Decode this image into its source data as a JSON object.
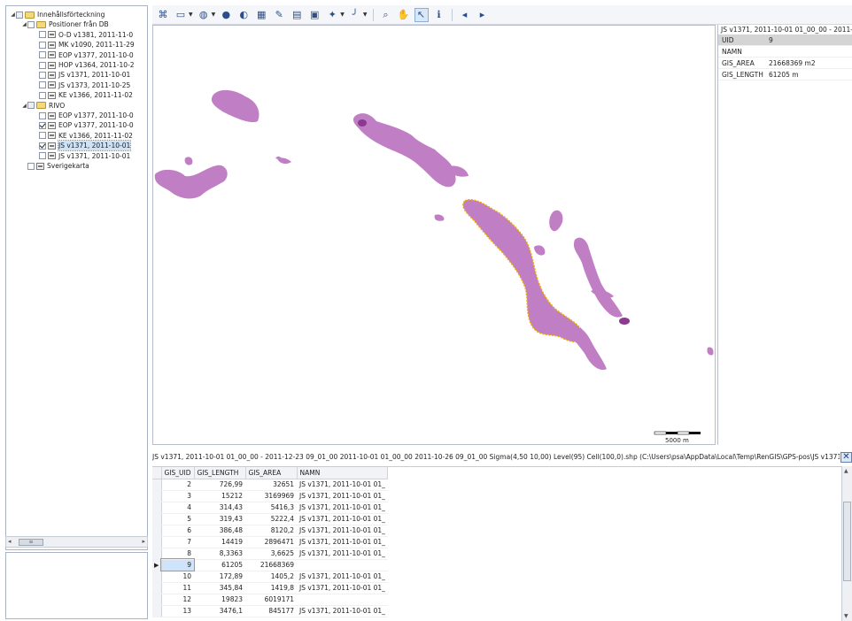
{
  "tree": {
    "items": [
      {
        "label": "Innehållsförteckning",
        "indent": 0,
        "icon": "folder-icon",
        "check": "partial",
        "expander": "▲"
      },
      {
        "label": "Positioner från DB",
        "indent": 1,
        "icon": "folder-icon",
        "check": "none",
        "expander": "▲"
      },
      {
        "label": "O-D v1381, 2011-11-0",
        "indent": 2,
        "icon": "layer-icon",
        "check": "none"
      },
      {
        "label": "MK v1090, 2011-11-29",
        "indent": 2,
        "icon": "layer-icon",
        "check": "none"
      },
      {
        "label": "EOP v1377, 2011-10-0",
        "indent": 2,
        "icon": "layer-icon",
        "check": "none"
      },
      {
        "label": "HOP v1364, 2011-10-2",
        "indent": 2,
        "icon": "layer-icon",
        "check": "none"
      },
      {
        "label": "JS v1371, 2011-10-01",
        "indent": 2,
        "icon": "layer-icon",
        "check": "none"
      },
      {
        "label": "JS v1373, 2011-10-25",
        "indent": 2,
        "icon": "layer-icon",
        "check": "none"
      },
      {
        "label": "KE v1366, 2011-11-02",
        "indent": 2,
        "icon": "layer-icon",
        "check": "none"
      },
      {
        "label": "RIVO",
        "indent": 1,
        "icon": "folder-icon",
        "check": "partial",
        "expander": "▲"
      },
      {
        "label": "EOP v1377, 2011-10-0",
        "indent": 2,
        "icon": "layer-icon",
        "check": "none"
      },
      {
        "label": "EOP v1377, 2011-10-0",
        "indent": 2,
        "icon": "layer-icon",
        "check": "checked"
      },
      {
        "label": "KE v1366, 2011-11-02",
        "indent": 2,
        "icon": "layer-icon",
        "check": "none"
      },
      {
        "label": "JS v1371, 2011-10-01",
        "indent": 2,
        "icon": "layer-icon",
        "check": "checked",
        "selected": true
      },
      {
        "label": "JS v1371, 2011-10-01",
        "indent": 2,
        "icon": "layer-icon",
        "check": "none"
      },
      {
        "label": "Sverigekarta",
        "indent": 1,
        "icon": "layer-icon",
        "check": "none"
      }
    ]
  },
  "toolbar": {
    "buttons": [
      {
        "name": "layers-icon",
        "glyph": "⌘"
      },
      {
        "name": "open-folder-icon",
        "glyph": "▭",
        "dropdown": true
      },
      {
        "name": "globe-icon",
        "glyph": "◍",
        "dropdown": true
      },
      {
        "name": "sphere-icon",
        "glyph": "●"
      },
      {
        "name": "half-sphere-icon",
        "glyph": "◐"
      },
      {
        "name": "grid-icon",
        "glyph": "▦"
      },
      {
        "name": "magic-wand-icon",
        "glyph": "✎"
      },
      {
        "name": "table-icon",
        "glyph": "▤"
      },
      {
        "name": "chart-icon",
        "glyph": "▣"
      },
      {
        "name": "paint-icon",
        "glyph": "✦",
        "dropdown": true
      },
      {
        "name": "line-tool-icon",
        "glyph": "╯",
        "dropdown": true
      },
      {
        "name": "zoom-icon",
        "glyph": "⌕"
      },
      {
        "name": "pan-icon",
        "glyph": "✋"
      },
      {
        "name": "select-arrow-icon",
        "glyph": "↖",
        "active": true
      },
      {
        "name": "identify-icon",
        "glyph": "ℹ"
      },
      {
        "name": "back-icon",
        "glyph": "◂"
      },
      {
        "name": "forward-icon",
        "glyph": "▸"
      }
    ]
  },
  "map": {
    "fill_color": "#c07ec4",
    "highlight_color": "#f0a500",
    "dark_spot_color": "#8a3a8f",
    "scale_label": "5000 m"
  },
  "properties": {
    "title": "JS v1371, 2011-10-01 01_00_00 - 2011-",
    "rows": [
      {
        "key": "UID",
        "value": "9",
        "header": true
      },
      {
        "key": "NAMN",
        "value": ""
      },
      {
        "key": "GIS_AREA",
        "value": "21668369 m2"
      },
      {
        "key": "GIS_LENGTH",
        "value": "61205 m"
      }
    ]
  },
  "table": {
    "path": "JS v1371, 2011-10-01 01_00_00 - 2011-12-23 09_01_00 2011-10-01 01_00_00 2011-10-26 09_01_00 Sigma(4,50 10,00) Level(95) Cell(100,0).shp (C:\\Users\\psa\\AppData\\Local\\Temp\\RenGIS\\GPS-pos\\JS v1371, 2",
    "columns": [
      "GIS_UID",
      "GIS_LENGTH",
      "GIS_AREA",
      "NAMN"
    ],
    "rows": [
      {
        "uid": "2",
        "length": "726,99",
        "area": "32651",
        "namn": "JS v1371, 2011-10-01 01_"
      },
      {
        "uid": "3",
        "length": "15212",
        "area": "3169969",
        "namn": "JS v1371, 2011-10-01 01_"
      },
      {
        "uid": "4",
        "length": "314,43",
        "area": "5416,3",
        "namn": "JS v1371, 2011-10-01 01_"
      },
      {
        "uid": "5",
        "length": "319,43",
        "area": "5222,4",
        "namn": "JS v1371, 2011-10-01 01_"
      },
      {
        "uid": "6",
        "length": "386,48",
        "area": "8120,2",
        "namn": "JS v1371, 2011-10-01 01_"
      },
      {
        "uid": "7",
        "length": "14419",
        "area": "2896471",
        "namn": "JS v1371, 2011-10-01 01_"
      },
      {
        "uid": "8",
        "length": "8,3363",
        "area": "3,6625",
        "namn": "JS v1371, 2011-10-01 01_"
      },
      {
        "uid": "9",
        "length": "61205",
        "area": "21668369",
        "namn": "",
        "current": true
      },
      {
        "uid": "10",
        "length": "172,89",
        "area": "1405,2",
        "namn": "JS v1371, 2011-10-01 01_"
      },
      {
        "uid": "11",
        "length": "345,84",
        "area": "1419,8",
        "namn": "JS v1371, 2011-10-01 01_"
      },
      {
        "uid": "12",
        "length": "19823",
        "area": "6019171",
        "namn": ""
      },
      {
        "uid": "13",
        "length": "3476,1",
        "area": "845177",
        "namn": "JS v1371, 2011-10-01 01_"
      }
    ]
  }
}
